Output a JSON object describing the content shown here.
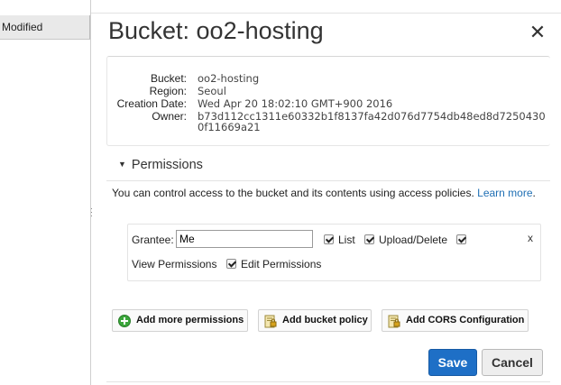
{
  "list_column": {
    "header": "Modified"
  },
  "panel": {
    "title": "Bucket: oo2-hosting",
    "close_glyph": "✕"
  },
  "properties": {
    "bucket_label": "Bucket:",
    "bucket_value": "oo2-hosting",
    "region_label": "Region:",
    "region_value": "Seoul",
    "created_label": "Creation Date:",
    "created_value": "Wed Apr 20 18:02:10 GMT+900 2016",
    "owner_label": "Owner:",
    "owner_value_line1": "b73d112cc1311e60332b1f8137fa42d076d7754db48ed8d7250430",
    "owner_value_line2": "0f11669a21"
  },
  "permissions": {
    "header": "Permissions",
    "description": "You can control access to the bucket and its contents using access policies.",
    "learn_more": "Learn more",
    "period": ".",
    "grantee_label": "Grantee:",
    "grantee_value": "Me",
    "list_label": "List",
    "upload_delete_label": "Upload/Delete",
    "view_permissions_label": "View Permissions",
    "edit_permissions_label": "Edit Permissions",
    "remove_glyph": "x",
    "checkboxes": {
      "list": true,
      "upload_delete": true,
      "view_permissions": true,
      "edit_permissions": true
    }
  },
  "actions": {
    "add_more_permissions": "Add more permissions",
    "add_bucket_policy": "Add bucket policy",
    "add_cors_configuration": "Add CORS Configuration"
  },
  "footer": {
    "save": "Save",
    "cancel": "Cancel"
  },
  "colors": {
    "primary": "#1e6fc6",
    "link": "#1f6fb4",
    "add_icon": "#3aa63a"
  }
}
